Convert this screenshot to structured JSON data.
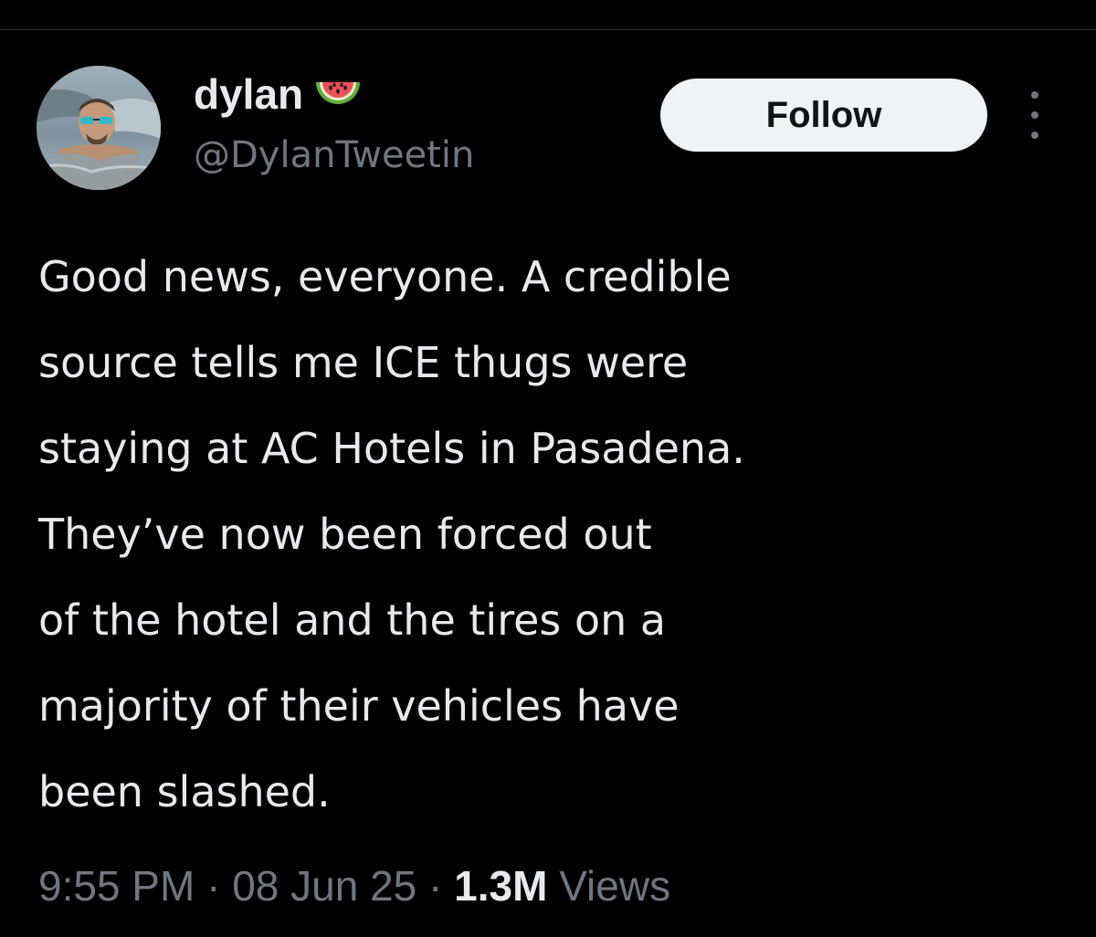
{
  "author": {
    "display_name": "dylan",
    "handle": "@DylanTweetin",
    "badge_icon": "watermelon-icon"
  },
  "actions": {
    "follow_label": "Follow",
    "more_icon": "more-vertical-icon"
  },
  "tweet": {
    "lines": [
      "Good news, everyone. A credible",
      "source tells me ICE thugs were",
      "staying at AC Hotels in Pasadena.",
      "They’ve now been forced out",
      "of the hotel and the tires on a",
      "majority of their vehicles have",
      "been slashed."
    ]
  },
  "meta": {
    "time": "9:55 PM",
    "separator": "·",
    "date": "08 Jun 25",
    "views_count": "1.3M",
    "views_label": "Views"
  },
  "colors": {
    "background": "#000000",
    "text": "#e7e9ea",
    "secondary_text": "#71767b",
    "follow_button_bg": "#eff3f4",
    "follow_button_text": "#0f1419"
  }
}
